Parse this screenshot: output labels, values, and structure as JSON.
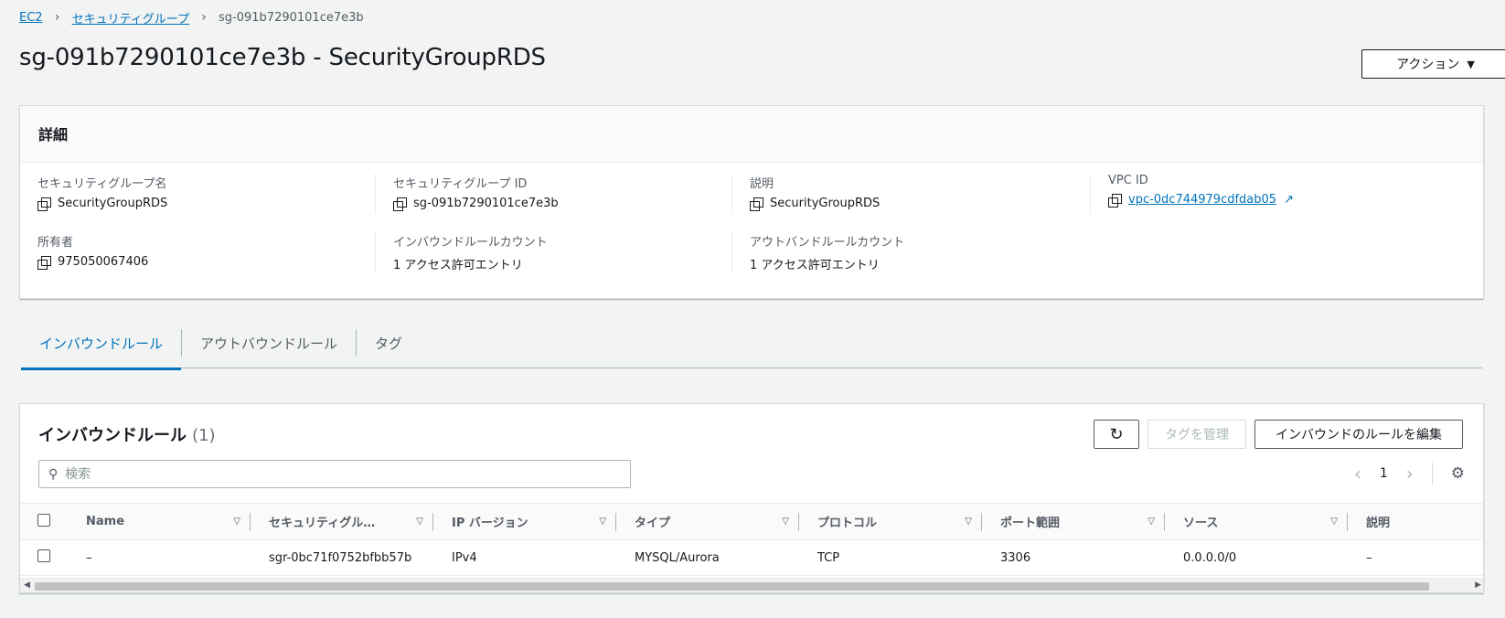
{
  "breadcrumb": {
    "items": [
      "EC2",
      "セキュリティグループ"
    ],
    "current": "sg-091b7290101ce7e3b"
  },
  "page": {
    "title": "sg-091b7290101ce7e3b - SecurityGroupRDS",
    "action_label": "アクション"
  },
  "details": {
    "header": "詳細",
    "fields": {
      "sg_name": {
        "label": "セキュリティグループ名",
        "value": "SecurityGroupRDS"
      },
      "sg_id": {
        "label": "セキュリティグループ ID",
        "value": "sg-091b7290101ce7e3b"
      },
      "description": {
        "label": "説明",
        "value": "SecurityGroupRDS"
      },
      "vpc_id": {
        "label": "VPC ID",
        "value": "vpc-0dc744979cdfdab05"
      },
      "owner": {
        "label": "所有者",
        "value": "975050067406"
      },
      "inbound_count": {
        "label": "インバウンドルールカウント",
        "value": "1 アクセス許可エントリ"
      },
      "outbound_count": {
        "label": "アウトバンドルールカウント",
        "value": "1 アクセス許可エントリ"
      }
    }
  },
  "tabs": [
    {
      "label": "インバウンドルール",
      "active": true
    },
    {
      "label": "アウトバウンドルール",
      "active": false
    },
    {
      "label": "タグ",
      "active": false
    }
  ],
  "rules": {
    "title": "インバウンドルール",
    "count": "(1)",
    "manage_tags_label": "タグを管理",
    "edit_label": "インバウンドのルールを編集",
    "search_placeholder": "検索",
    "page": "1",
    "columns": [
      "Name",
      "セキュリティグル…",
      "IP バージョン",
      "タイプ",
      "プロトコル",
      "ポート範囲",
      "ソース",
      "説明"
    ],
    "rows": [
      [
        "–",
        "sgr-0bc71f0752bfbb57b",
        "IPv4",
        "MYSQL/Aurora",
        "TCP",
        "3306",
        "0.0.0.0/0",
        "–"
      ]
    ]
  },
  "colors": {
    "link": "#0073bb",
    "text": "#16191f",
    "background": "#f2f3f3"
  }
}
